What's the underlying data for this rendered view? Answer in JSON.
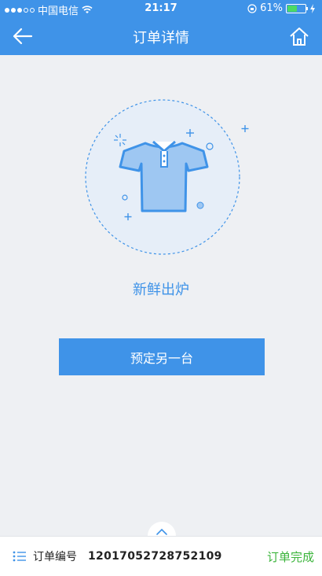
{
  "status_bar": {
    "carrier": "中国电信",
    "time": "21:17",
    "battery": "61%",
    "battery_level": 0.61
  },
  "header": {
    "title": "订单详情",
    "back_icon": "arrow-left-icon",
    "home_icon": "home-icon"
  },
  "main": {
    "illustration_icon": "polo-shirt-icon",
    "status_title": "新鲜出炉",
    "reorder_label": "预定另一台"
  },
  "bottom_bar": {
    "icon": "list-icon",
    "label": "订单编号",
    "order_number": "12017052728752109",
    "status": "订单完成"
  },
  "colors": {
    "primary": "#3f93e8",
    "success": "#3bb43b",
    "background": "#eef0f3"
  }
}
